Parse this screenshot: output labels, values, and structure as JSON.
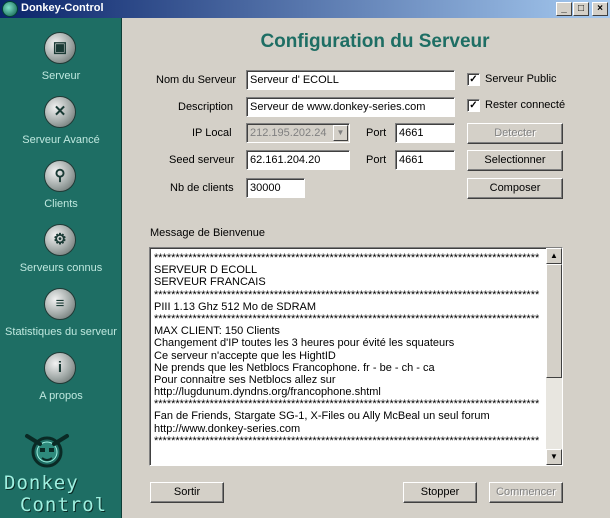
{
  "window": {
    "title": "Donkey-Control",
    "min_glyph": "_",
    "max_glyph": "□",
    "close_glyph": "×"
  },
  "sidebar": {
    "items": [
      {
        "label": "Serveur",
        "icon": "server-icon",
        "glyph": "▣"
      },
      {
        "label": "Serveur Avancé",
        "icon": "server-advanced-icon",
        "glyph": "✕"
      },
      {
        "label": "Clients",
        "icon": "clients-icon",
        "glyph": "⚲"
      },
      {
        "label": "Serveurs connus",
        "icon": "known-servers-icon",
        "glyph": "⚙"
      },
      {
        "label": "Statistiques du serveur",
        "icon": "statistics-icon",
        "glyph": "≡"
      },
      {
        "label": "A propos",
        "icon": "about-icon",
        "glyph": "i"
      }
    ],
    "logo_line1": "Donkey",
    "logo_line2": "Control"
  },
  "main": {
    "title": "Configuration du Serveur",
    "server_name_label": "Nom du Serveur",
    "server_name_value": "Serveur d' ECOLL",
    "description_label": "Description",
    "description_value": "Serveur de www.donkey-series.com",
    "ip_local_label": "IP Local",
    "ip_local_value": "212.195.202.24",
    "port_label": "Port",
    "ip_port_value": "4661",
    "seed_label": "Seed serveur",
    "seed_value": "62.161.204.20",
    "seed_port_value": "4661",
    "nb_clients_label": "Nb de clients",
    "nb_clients_value": "30000",
    "public_server_label": "Serveur Public",
    "public_server_checked": true,
    "stay_connected_label": "Rester connecté",
    "stay_connected_checked": true,
    "detect_button": "Detecter",
    "select_button": "Selectionner",
    "compose_button": "Composer",
    "welcome_label": "Message de Bienvenue",
    "welcome_lines": [
      "******************************************************************************************",
      "SERVEUR D ECOLL",
      "SERVEUR  FRANCAIS",
      "******************************************************************************************",
      "PIII 1.13 Ghz 512 Mo de SDRAM",
      "******************************************************************************************",
      "MAX CLIENT: 150 Clients",
      "Changement d'IP toutes les 3 heures pour évité les squateurs",
      "Ce serveur n'accepte que les HightID",
      "Ne prends que les Netblocs Francophone. fr - be - ch - ca",
      "Pour connaitre ses Netblocs allez sur",
      "http://lugdunum.dyndns.org/francophone.shtml",
      "******************************************************************************************",
      "Fan de Friends, Stargate SG-1, X-Files ou Ally McBeal un seul forum",
      "http://www.donkey-series.com",
      "******************************************************************************************"
    ],
    "quit_button": "Sortir",
    "stop_button": "Stopper",
    "start_button": "Commencer",
    "check_glyph": "✓",
    "combo_arrow_glyph": "▼",
    "scroll_up_glyph": "▲",
    "scroll_down_glyph": "▼"
  }
}
